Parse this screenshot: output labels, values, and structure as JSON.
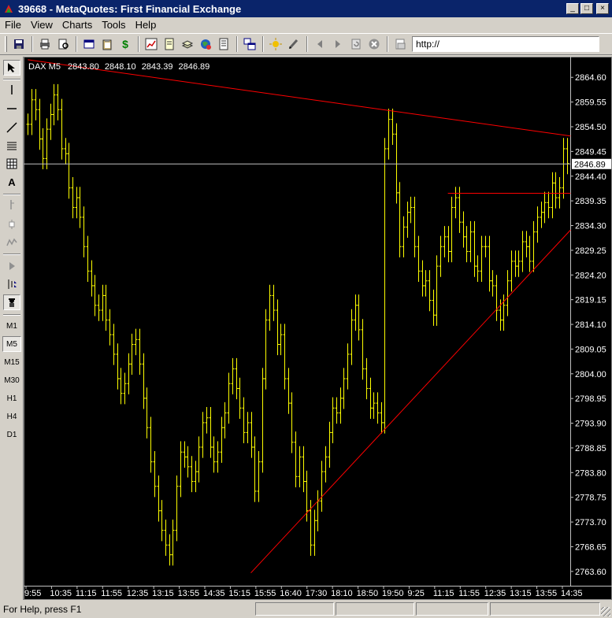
{
  "window": {
    "title": "39668 - MetaQuotes: First Financial Exchange",
    "minimize": "_",
    "maximize": "□",
    "close": "×"
  },
  "menu": {
    "items": [
      {
        "label": "File"
      },
      {
        "label": "View"
      },
      {
        "label": "Charts"
      },
      {
        "label": "Tools"
      },
      {
        "label": "Help"
      }
    ]
  },
  "toolbar": {
    "address_value": "http://",
    "icons": [
      "save-icon",
      "print-icon",
      "print-preview-icon",
      "new-window-icon",
      "clipboard-icon",
      "dollar-icon",
      "chart-icon",
      "page-icon",
      "stack-icon",
      "globe-icon",
      "page-list-icon",
      "windows-icon",
      "sun-icon",
      "pen-icon",
      "back-icon",
      "forward-icon",
      "refresh-icon",
      "stop-icon",
      "page-address-icon"
    ]
  },
  "left_toolbar": {
    "tools": [
      "cursor-icon",
      "vertical-line-icon",
      "horizontal-line-icon",
      "trend-line-icon",
      "channel-icon",
      "grid-icon",
      "text-icon",
      "fib-icon",
      "candle-icon",
      "indicator-icon",
      "scroll-icon",
      "period-icon",
      "expert-icon"
    ],
    "timeframes": [
      "M1",
      "M5",
      "M15",
      "M30",
      "H1",
      "H4",
      "D1"
    ],
    "active_timeframe": "M5"
  },
  "chart_data": {
    "type": "line",
    "symbol_label": "DAX M5",
    "ohlc": [
      "2843.80",
      "2848.10",
      "2843.39",
      "2846.89"
    ],
    "current_price_label": "2846.89",
    "current_price": 2846.89,
    "ylim": [
      2761.0,
      2868.5
    ],
    "y_ticks": [
      "2864.60",
      "2859.55",
      "2854.50",
      "2849.45",
      "2844.40",
      "2839.35",
      "2834.30",
      "2829.25",
      "2824.20",
      "2819.15",
      "2814.10",
      "2809.05",
      "2804.00",
      "2798.95",
      "2793.90",
      "2788.85",
      "2783.80",
      "2778.75",
      "2773.70",
      "2768.65",
      "2763.60"
    ],
    "x_ticks": [
      "9:55",
      "10:35",
      "11:15",
      "11:55",
      "12:35",
      "13:15",
      "13:55",
      "14:35",
      "15:15",
      "15:55",
      "16:40",
      "17:30",
      "18:10",
      "18:50",
      "19:50",
      "9:25",
      "11:15",
      "11:55",
      "12:35",
      "13:15",
      "13:55",
      "14:35"
    ],
    "close_series": [
      2855,
      2860,
      2858,
      2852,
      2848,
      2854,
      2857,
      2861,
      2858,
      2850,
      2849,
      2842,
      2838,
      2840,
      2836,
      2830,
      2825,
      2822,
      2818,
      2817,
      2820,
      2815,
      2812,
      2808,
      2803,
      2800,
      2802,
      2806,
      2810,
      2811,
      2806,
      2799,
      2793,
      2786,
      2781,
      2776,
      2772,
      2769,
      2767,
      2772,
      2781,
      2788,
      2787,
      2785,
      2782,
      2784,
      2789,
      2794,
      2795,
      2789,
      2786,
      2788,
      2793,
      2796,
      2802,
      2805,
      2801,
      2797,
      2792,
      2794,
      2789,
      2780,
      2786,
      2803,
      2815,
      2820,
      2817,
      2810,
      2812,
      2803,
      2798,
      2790,
      2783,
      2787,
      2782,
      2776,
      2769,
      2774,
      2778,
      2784,
      2787,
      2792,
      2797,
      2796,
      2799,
      2803,
      2808,
      2815,
      2818,
      2813,
      2805,
      2801,
      2797,
      2798,
      2796,
      2794,
      2850,
      2856,
      2853,
      2841,
      2830,
      2834,
      2837,
      2838,
      2830,
      2825,
      2822,
      2823,
      2819,
      2816,
      2826,
      2830,
      2832,
      2829,
      2838,
      2840,
      2835,
      2832,
      2829,
      2833,
      2826,
      2825,
      2830,
      2830,
      2823,
      2822,
      2817,
      2815,
      2818,
      2823,
      2827,
      2826,
      2827,
      2831,
      2830,
      2827,
      2833,
      2836,
      2837,
      2839,
      2838,
      2843,
      2840,
      2842,
      2850,
      2847
    ],
    "lines": [
      {
        "from_bar": 0,
        "from_price": 2868.2,
        "to_bar": 145,
        "to_price": 2852.6,
        "color": "#ff0000"
      },
      {
        "from_bar": 113,
        "from_price": 2840.9,
        "to_bar": 145,
        "to_price": 2840.9,
        "color": "#ff0000"
      },
      {
        "from_bar": 60,
        "from_price": 2763.3,
        "to_bar": 145,
        "to_price": 2833.4,
        "color": "#ff0000"
      }
    ],
    "bar_color": "#ffff00",
    "background": "#000000",
    "grid": false
  },
  "status": {
    "help_text": "For Help, press F1"
  }
}
